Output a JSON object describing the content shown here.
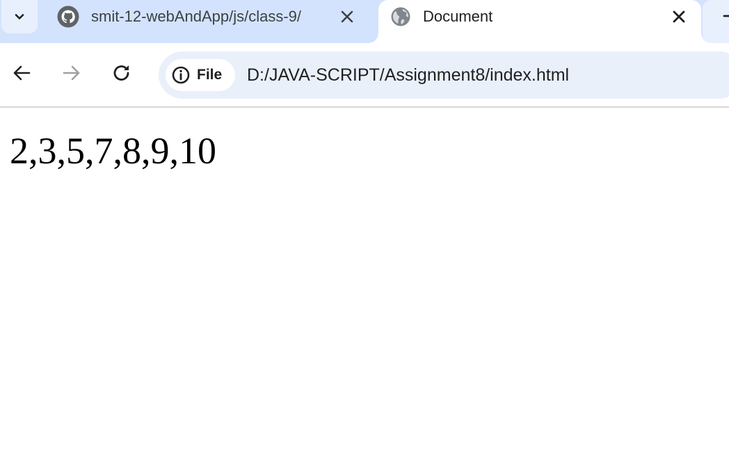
{
  "browser": {
    "tabs": [
      {
        "title": "smit-12-webAndApp/js/class-9/",
        "favicon": "github-icon",
        "active": false
      },
      {
        "title": "Document",
        "favicon": "globe-icon",
        "active": true
      }
    ],
    "address_bar": {
      "security_chip_label": "File",
      "security_icon": "info-icon",
      "url": "D:/JAVA-SCRIPT/Assignment8/index.html"
    },
    "nav_icons": [
      "back-arrow-icon",
      "forward-arrow-icon",
      "reload-icon"
    ],
    "colors": {
      "tabstrip": "#d3e3fd",
      "omnibox": "#eaf0fa",
      "active_tab": "#ffffff"
    }
  },
  "page": {
    "output_text": "2,3,5,7,8,9,10"
  }
}
